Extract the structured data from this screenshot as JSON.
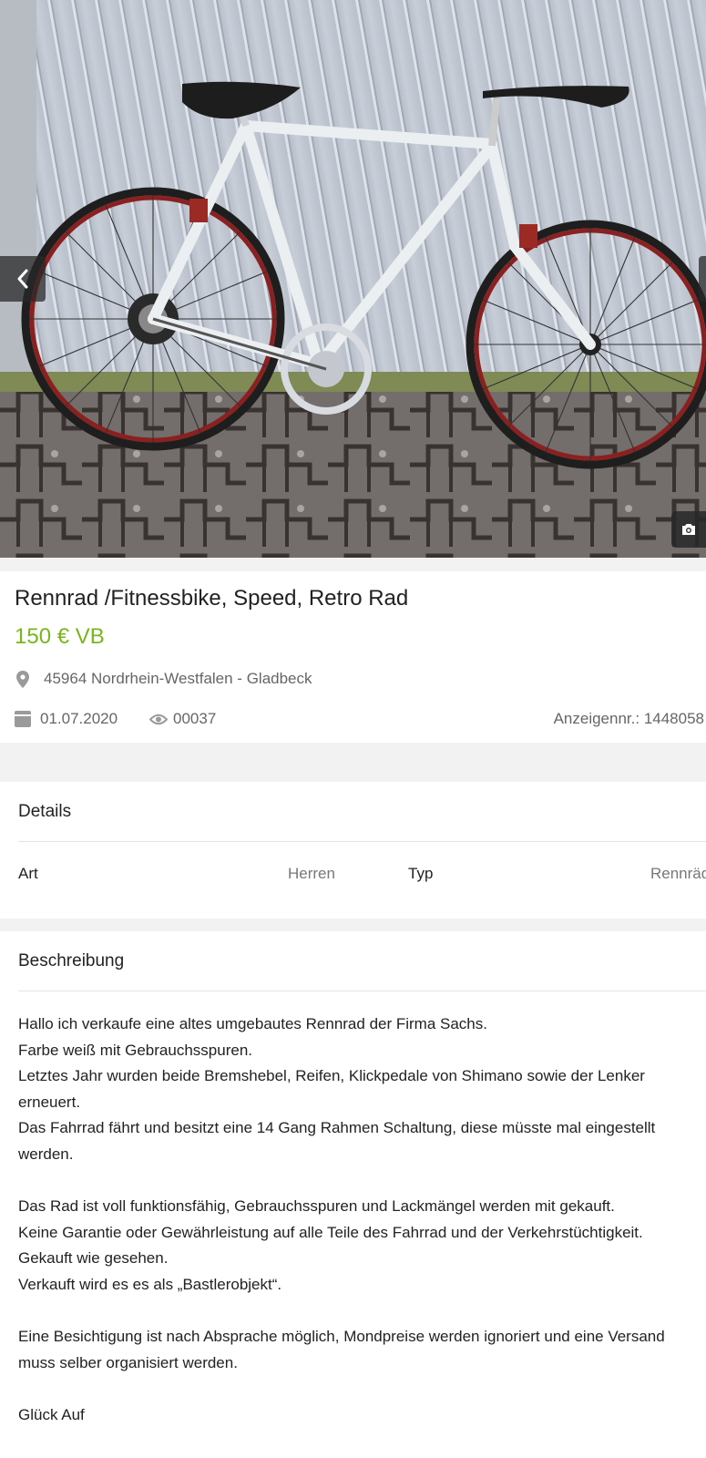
{
  "gallery": {
    "image_alt": "Weißes Rennrad mit roten Schutzblechen vor Garagentor",
    "prev_icon": "chevron-left-icon",
    "camera_icon": "camera-icon"
  },
  "ad": {
    "title": "Rennrad /Fitnessbike, Speed, Retro Rad",
    "price": "150 € VB",
    "location": "45964 Nordrhein-Westfalen - Gladbeck",
    "date": "01.07.2020",
    "views": "00037",
    "ad_number": "Anzeigennr.: 1448058",
    "location_icon": "map-pin-icon",
    "date_icon": "calendar-icon",
    "views_icon": "eye-icon"
  },
  "details": {
    "title": "Details",
    "rows": [
      {
        "label": "Art",
        "value": "Herren"
      },
      {
        "label": "Typ",
        "value": "Rennräder"
      }
    ]
  },
  "description": {
    "title": "Beschreibung",
    "lines": [
      "Hallo ich verkaufe eine altes umgebautes Rennrad der Firma Sachs.",
      "Farbe weiß mit Gebrauchsspuren.",
      "Letztes Jahr wurden beide Bremshebel, Reifen, Klickpedale von Shimano sowie der Lenker erneuert.",
      "Das Fahrrad fährt und besitzt eine 14 Gang Rahmen Schaltung, diese müsste mal eingestellt werden.",
      "",
      "Das Rad ist voll funktionsfähig, Gebrauchsspuren und Lackmängel werden mit gekauft.",
      "Keine Garantie oder Gewährleistung auf alle Teile des Fahrrad und der Verkehrstüchtigkeit.",
      "Gekauft wie gesehen.",
      "Verkauft wird es es als „Bastlerobjekt“.",
      "",
      "Eine Besichtigung ist nach Absprache möglich, Mondpreise werden ignoriert und eine Versand muss selber organisiert werden.",
      "",
      "Glück Auf"
    ]
  },
  "colors": {
    "price": "#7ab51d",
    "muted_text": "#666666",
    "band": "#f2f2f2"
  }
}
